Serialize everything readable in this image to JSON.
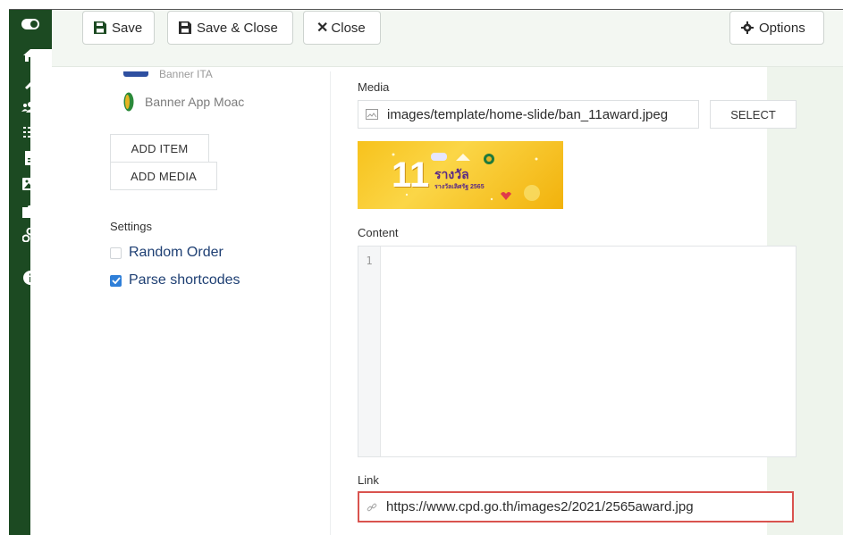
{
  "toolbar": {
    "save_label": "Save",
    "save_close_label": "Save & Close",
    "close_label": "Close",
    "options_label": "Options"
  },
  "sidebar": {
    "icons": [
      "toggle-icon",
      "home-icon",
      "wrench-icon",
      "users-icon",
      "list-icon",
      "file-icon",
      "image-icon",
      "puzzle-icon",
      "share-icon",
      "info-icon"
    ]
  },
  "items": {
    "partial_label": "Banner ITA",
    "app_label": "Banner App Moac",
    "add_item_label": "ADD ITEM",
    "add_media_label": "ADD MEDIA"
  },
  "settings": {
    "label": "Settings",
    "random_order_label": "Random Order",
    "random_order_checked": false,
    "parse_shortcodes_label": "Parse shortcodes",
    "parse_shortcodes_checked": true
  },
  "media": {
    "label": "Media",
    "value": "images/template/home-slide/ban_11award.jpeg",
    "select_label": "SELECT",
    "thumb_big": "11",
    "thumb_line1": "รางวัล",
    "thumb_line2": "รางวัลเลิศรัฐ 2565"
  },
  "content": {
    "label": "Content",
    "line_number": "1"
  },
  "link": {
    "label": "Link",
    "value": "https://www.cpd.go.th/images2/2021/2565award.jpg"
  },
  "colors": {
    "sidebar": "#1c4a22",
    "workspace": "#eef4ec",
    "highlight": "#d9534f",
    "check": "#2f7fd8",
    "option_text": "#1e3f73"
  }
}
